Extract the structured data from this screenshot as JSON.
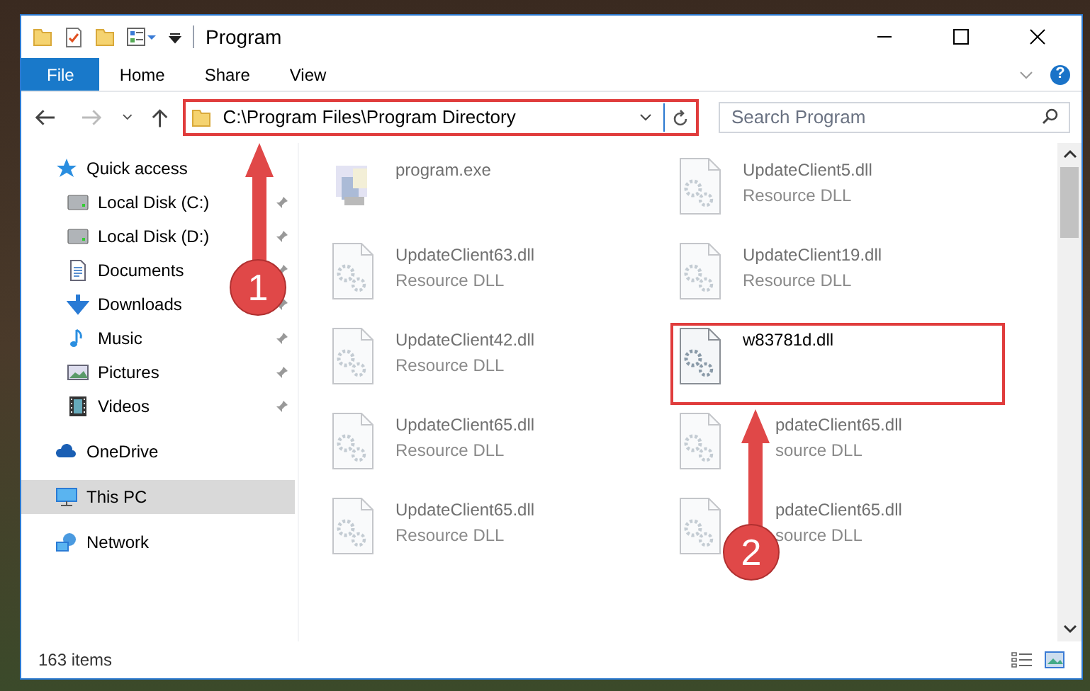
{
  "window": {
    "title": "Program"
  },
  "ribbon": {
    "tabs": [
      {
        "label": "File",
        "selected": true
      },
      {
        "label": "Home",
        "selected": false
      },
      {
        "label": "Share",
        "selected": false
      },
      {
        "label": "View",
        "selected": false
      }
    ],
    "help": "?"
  },
  "address": {
    "path": "C:\\Program Files\\Program Directory",
    "highlighted": true
  },
  "search": {
    "placeholder": "Search Program"
  },
  "sidebar": {
    "items": [
      {
        "label": "Quick access",
        "kind": "star",
        "selected": false,
        "children": [
          {
            "label": "Local Disk (C:)",
            "kind": "drive",
            "pinned": true,
            "selected": false
          },
          {
            "label": "Local Disk (D:)",
            "kind": "drive",
            "pinned": true,
            "selected": false
          },
          {
            "label": "Documents",
            "kind": "documents",
            "pinned": true,
            "selected": false
          },
          {
            "label": "Downloads",
            "kind": "download",
            "pinned": true,
            "selected": false
          },
          {
            "label": "Music",
            "kind": "music",
            "pinned": true,
            "selected": false
          },
          {
            "label": "Pictures",
            "kind": "pictures",
            "pinned": true,
            "selected": false
          },
          {
            "label": "Videos",
            "kind": "videos",
            "pinned": true,
            "selected": false
          }
        ]
      },
      {
        "label": "OneDrive",
        "kind": "cloud",
        "selected": false
      },
      {
        "label": "This PC",
        "kind": "pc",
        "selected": true
      },
      {
        "label": "Network",
        "kind": "network",
        "selected": false
      }
    ]
  },
  "files": [
    {
      "name": "program.exe",
      "kind": "exe",
      "blurred": true,
      "highlighted": false
    },
    {
      "name": "UpdateClient5.dll",
      "type": "Resource DLL",
      "kind": "dll",
      "blurred": true,
      "highlighted": false
    },
    {
      "name": "UpdateClient63.dll",
      "type": "Resource DLL",
      "kind": "dll",
      "blurred": true,
      "highlighted": false
    },
    {
      "name": "UpdateClient19.dll",
      "type": "Resource DLL",
      "kind": "dll",
      "blurred": true,
      "highlighted": false
    },
    {
      "name": "UpdateClient42.dll",
      "type": "Resource DLL",
      "kind": "dll",
      "blurred": true,
      "highlighted": false
    },
    {
      "name": "w83781d.dll",
      "kind": "dll",
      "blurred": false,
      "highlighted": true
    },
    {
      "name": "UpdateClient65.dll",
      "type": "Resource DLL",
      "kind": "dll",
      "blurred": true,
      "highlighted": false,
      "cut_start": false
    },
    {
      "name": "pdateClient65.dll",
      "type": "source DLL",
      "kind": "dll",
      "blurred": true,
      "highlighted": false,
      "cut_start": true
    },
    {
      "name": "UpdateClient65.dll",
      "type": "Resource DLL",
      "kind": "dll",
      "blurred": true,
      "highlighted": false,
      "cut_start": false
    },
    {
      "name": "pdateClient65.dll",
      "type": "source DLL",
      "kind": "dll",
      "blurred": true,
      "highlighted": false,
      "cut_start": true
    }
  ],
  "status_bar": {
    "text": "163 items"
  },
  "callouts": [
    {
      "number": "1"
    },
    {
      "number": "2"
    }
  ]
}
